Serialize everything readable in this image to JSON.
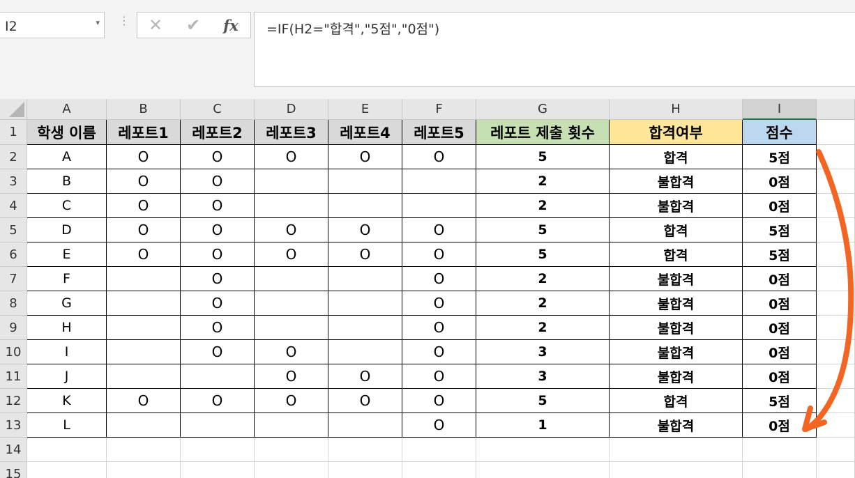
{
  "name_box": {
    "value": "I2",
    "arrow": "▾"
  },
  "formula_bar": {
    "separator": "⋮",
    "cancel_icon": "✕",
    "enter_icon": "✔",
    "fx_label": "fx",
    "formula": "=IF(H2=\"합격\",\"5점\",\"0점\")"
  },
  "columns": [
    "A",
    "B",
    "C",
    "D",
    "E",
    "F",
    "G",
    "H",
    "I"
  ],
  "row_numbers": [
    "1",
    "2",
    "3",
    "4",
    "5",
    "6",
    "7",
    "8",
    "9",
    "10",
    "11",
    "12",
    "13",
    "14",
    "15"
  ],
  "header_row": [
    "학생 이름",
    "레포트1",
    "레포트2",
    "레포트3",
    "레포트4",
    "레포트5",
    "레포트 제출 횟수",
    "합격여부",
    "점수"
  ],
  "header_colors": {
    "default": "#d9d9d9",
    "submission_count": "#c6e0b4",
    "pass_status": "#ffe699",
    "score": "#bdd7ee"
  },
  "rows": [
    [
      "A",
      "O",
      "O",
      "O",
      "O",
      "O",
      "5",
      "합격",
      "5점"
    ],
    [
      "B",
      "O",
      "O",
      "",
      "",
      "",
      "2",
      "불합격",
      "0점"
    ],
    [
      "C",
      "O",
      "O",
      "",
      "",
      "",
      "2",
      "불합격",
      "0점"
    ],
    [
      "D",
      "O",
      "O",
      "O",
      "O",
      "O",
      "5",
      "합격",
      "5점"
    ],
    [
      "E",
      "O",
      "O",
      "O",
      "O",
      "O",
      "5",
      "합격",
      "5점"
    ],
    [
      "F",
      "",
      "O",
      "",
      "",
      "O",
      "2",
      "불합격",
      "0점"
    ],
    [
      "G",
      "",
      "O",
      "",
      "",
      "O",
      "2",
      "불합격",
      "0점"
    ],
    [
      "H",
      "",
      "O",
      "",
      "",
      "O",
      "2",
      "불합격",
      "0점"
    ],
    [
      "I",
      "",
      "O",
      "O",
      "",
      "O",
      "3",
      "불합격",
      "0점"
    ],
    [
      "J",
      "",
      "",
      "O",
      "O",
      "O",
      "3",
      "불합격",
      "0점"
    ],
    [
      "K",
      "O",
      "O",
      "O",
      "O",
      "O",
      "5",
      "합격",
      "5점"
    ],
    [
      "L",
      "",
      "",
      "",
      "",
      "O",
      "1",
      "불합격",
      "0점"
    ]
  ],
  "annotation": {
    "type": "hand-drawn-arrow",
    "color": "#f26522"
  }
}
